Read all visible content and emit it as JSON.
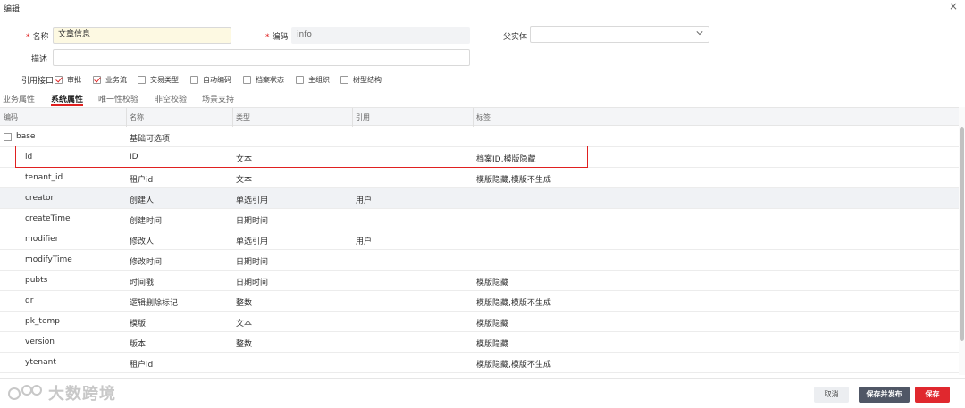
{
  "dialog": {
    "title": "编辑"
  },
  "form": {
    "name_label": "名称",
    "name_value": "文章信息",
    "code_label": "编码",
    "code_value": "info",
    "parent_label": "父实体",
    "parent_value": "",
    "desc_label": "描述",
    "desc_value": "",
    "interfaces_label": "引用接口",
    "interfaces": [
      {
        "label": "审批",
        "checked": true
      },
      {
        "label": "业务流",
        "checked": true
      },
      {
        "label": "交易类型",
        "checked": false
      },
      {
        "label": "自动编码",
        "checked": false
      },
      {
        "label": "档案状态",
        "checked": false
      },
      {
        "label": "主组织",
        "checked": false
      },
      {
        "label": "树型结构",
        "checked": false
      }
    ]
  },
  "tabs": [
    {
      "label": "业务属性",
      "active": false
    },
    {
      "label": "系统属性",
      "active": true
    },
    {
      "label": "唯一性校验",
      "active": false
    },
    {
      "label": "非空校验",
      "active": false
    },
    {
      "label": "场景支持",
      "active": false
    }
  ],
  "table": {
    "columns": [
      "编码",
      "名称",
      "类型",
      "引用",
      "标签"
    ],
    "group": {
      "code": "base",
      "name": "基础可选项"
    },
    "rows": [
      {
        "code": "id",
        "name": "ID",
        "type": "文本",
        "ref": "",
        "tags": "档案ID,模版隐藏"
      },
      {
        "code": "tenant_id",
        "name": "租户id",
        "type": "文本",
        "ref": "",
        "tags": "模版隐藏,模版不生成"
      },
      {
        "code": "creator",
        "name": "创建人",
        "type": "单选引用",
        "ref": "用户",
        "tags": ""
      },
      {
        "code": "createTime",
        "name": "创建时间",
        "type": "日期时间",
        "ref": "",
        "tags": ""
      },
      {
        "code": "modifier",
        "name": "修改人",
        "type": "单选引用",
        "ref": "用户",
        "tags": ""
      },
      {
        "code": "modifyTime",
        "name": "修改时间",
        "type": "日期时间",
        "ref": "",
        "tags": ""
      },
      {
        "code": "pubts",
        "name": "时间戳",
        "type": "日期时间",
        "ref": "",
        "tags": "模版隐藏"
      },
      {
        "code": "dr",
        "name": "逻辑删除标记",
        "type": "整数",
        "ref": "",
        "tags": "模版隐藏,模版不生成"
      },
      {
        "code": "pk_temp",
        "name": "模版",
        "type": "文本",
        "ref": "",
        "tags": "模版隐藏"
      },
      {
        "code": "version",
        "name": "版本",
        "type": "整数",
        "ref": "",
        "tags": "模版隐藏"
      },
      {
        "code": "ytenant",
        "name": "租户id",
        "type": "",
        "ref": "",
        "tags": "模版隐藏,模版不生成"
      }
    ]
  },
  "footer": {
    "cancel": "取消",
    "save_publish": "保存并发布",
    "save": "保存",
    "watermark": "大数跨境"
  },
  "colors": {
    "accent": "#e0282e",
    "dark_button": "#505766"
  }
}
